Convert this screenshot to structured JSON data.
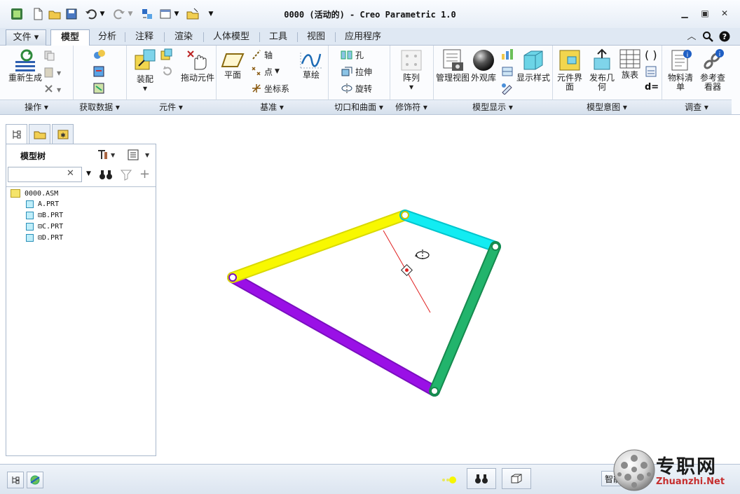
{
  "window": {
    "title": "0000 (活动的) - Creo Parametric 1.0"
  },
  "quick_access": {
    "icons": [
      "app-icon",
      "new-icon",
      "open-icon",
      "save-icon",
      "undo-icon",
      "redo-icon",
      "regenerate-icon",
      "windows-icon",
      "close-window-icon",
      "customize-icon"
    ]
  },
  "tabs": {
    "file": "文件",
    "items": [
      "模型",
      "分析",
      "注释",
      "渲染",
      "人体模型",
      "工具",
      "视图",
      "应用程序"
    ],
    "active": "模型"
  },
  "ribbon": {
    "operations": {
      "label": "操作",
      "regenerate": "重新生成"
    },
    "get_data": {
      "label": "获取数据"
    },
    "component": {
      "label": "元件",
      "assemble": "装配",
      "drag": "拖动元件"
    },
    "datum": {
      "label": "基准",
      "plane": "平面",
      "axis": "轴",
      "point": "点",
      "csys": "坐标系",
      "sketch": "草绘"
    },
    "cut_surface": {
      "label": "切口和曲面",
      "hole": "孔",
      "extrude": "拉伸",
      "revolve": "旋转"
    },
    "modifiers": {
      "label": "修饰符",
      "pattern": "阵列"
    },
    "model_display": {
      "label": "模型显示",
      "manage_views": "管理视图",
      "appearance": "外观库",
      "display_style": "显示样式"
    },
    "model_intent": {
      "label": "模型意图",
      "component_interface": "元件界面",
      "publish_geometry": "发布几何",
      "family_table": "族表"
    },
    "investigate": {
      "label": "调查",
      "bom": "物料清单",
      "reference_viewer": "参考查看器"
    }
  },
  "model_tree": {
    "title": "模型树",
    "search_value": "",
    "root": "0000.ASM",
    "items": [
      "A.PRT",
      "⊡B.PRT",
      "⊡C.PRT",
      "⊡D.PRT"
    ]
  },
  "viewport": {
    "links": [
      {
        "name": "A",
        "color": "#f5f500"
      },
      {
        "name": "B",
        "color": "#00e0e8"
      },
      {
        "name": "C",
        "color": "#1faa63"
      },
      {
        "name": "D",
        "color": "#9a10e6"
      }
    ]
  },
  "status": {
    "smart_filter": "智能"
  },
  "watermark": {
    "cn": "专职网",
    "en": "Zhuanzhi.Net"
  }
}
